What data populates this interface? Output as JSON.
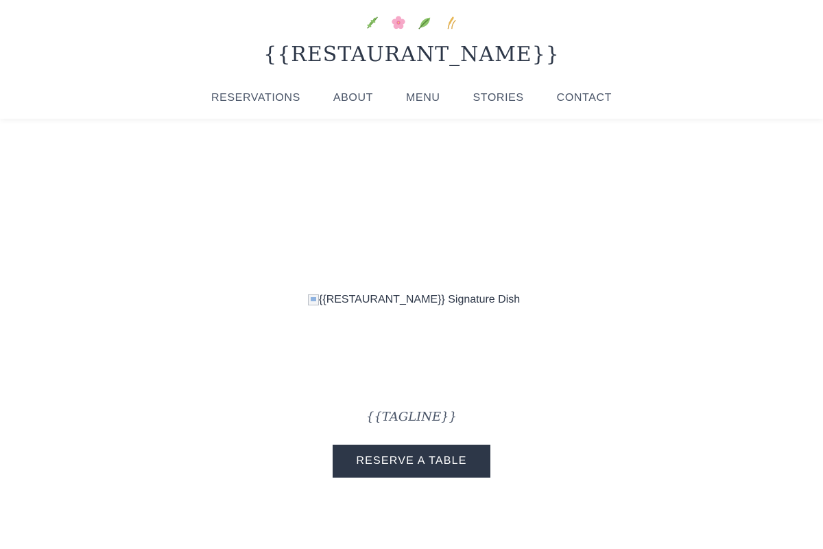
{
  "header": {
    "decor_icons": [
      "herb-icon",
      "cherry-blossom-icon",
      "leaf-icon",
      "wheat-icon"
    ],
    "brand": "{{RESTAURANT_NAME}}",
    "nav": [
      {
        "label": "RESERVATIONS"
      },
      {
        "label": "ABOUT"
      },
      {
        "label": "MENU"
      },
      {
        "label": "STORIES"
      },
      {
        "label": "CONTACT"
      }
    ]
  },
  "hero": {
    "image_alt": "{{RESTAURANT_NAME}} Signature Dish",
    "tagline": "{{TAGLINE}}",
    "cta_label": "RESERVE A TABLE"
  },
  "colors": {
    "primary": "#2d3748",
    "nav_text": "#4a5568",
    "background": "#ffffff"
  }
}
